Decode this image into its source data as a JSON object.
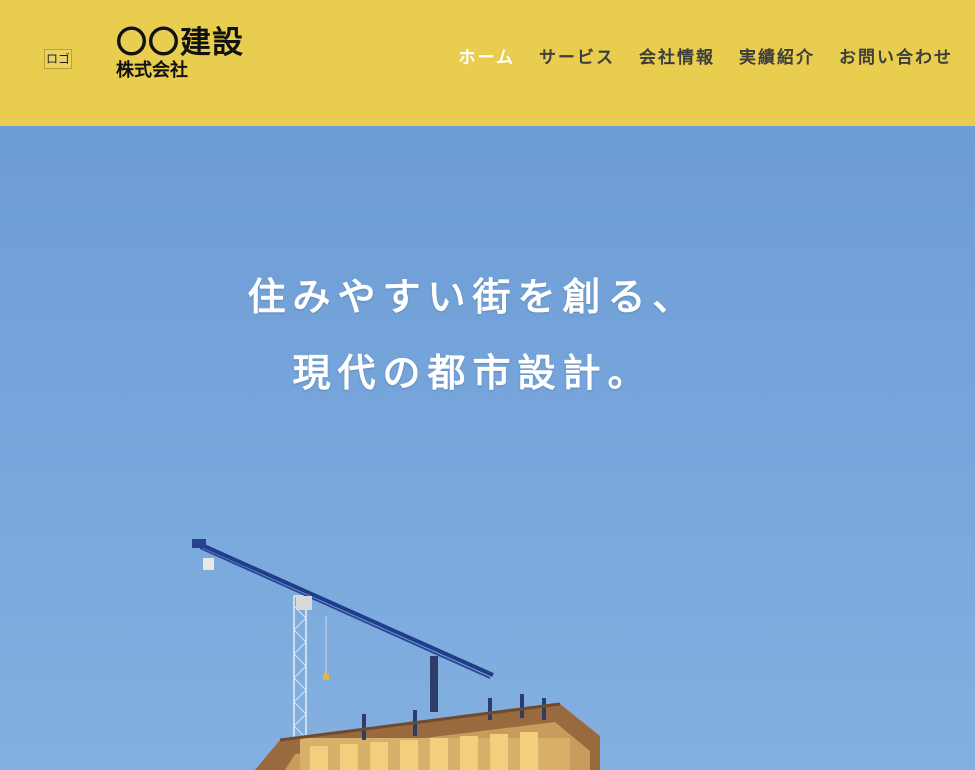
{
  "header": {
    "logo_placeholder": "ロゴ",
    "company_name": "〇〇建設",
    "company_suffix": "株式会社",
    "background_color": "#e8cd4e"
  },
  "nav": {
    "items": [
      {
        "label": "ホーム",
        "active": true
      },
      {
        "label": "サービス",
        "active": false
      },
      {
        "label": "会社情報",
        "active": false
      },
      {
        "label": "実績紹介",
        "active": false
      },
      {
        "label": "お問い合わせ",
        "active": false
      }
    ]
  },
  "hero": {
    "tagline_line1": "住みやすい街を創る、",
    "tagline_line2": "現代の都市設計。",
    "image_subject": "tower crane over building under construction against blue sky"
  }
}
